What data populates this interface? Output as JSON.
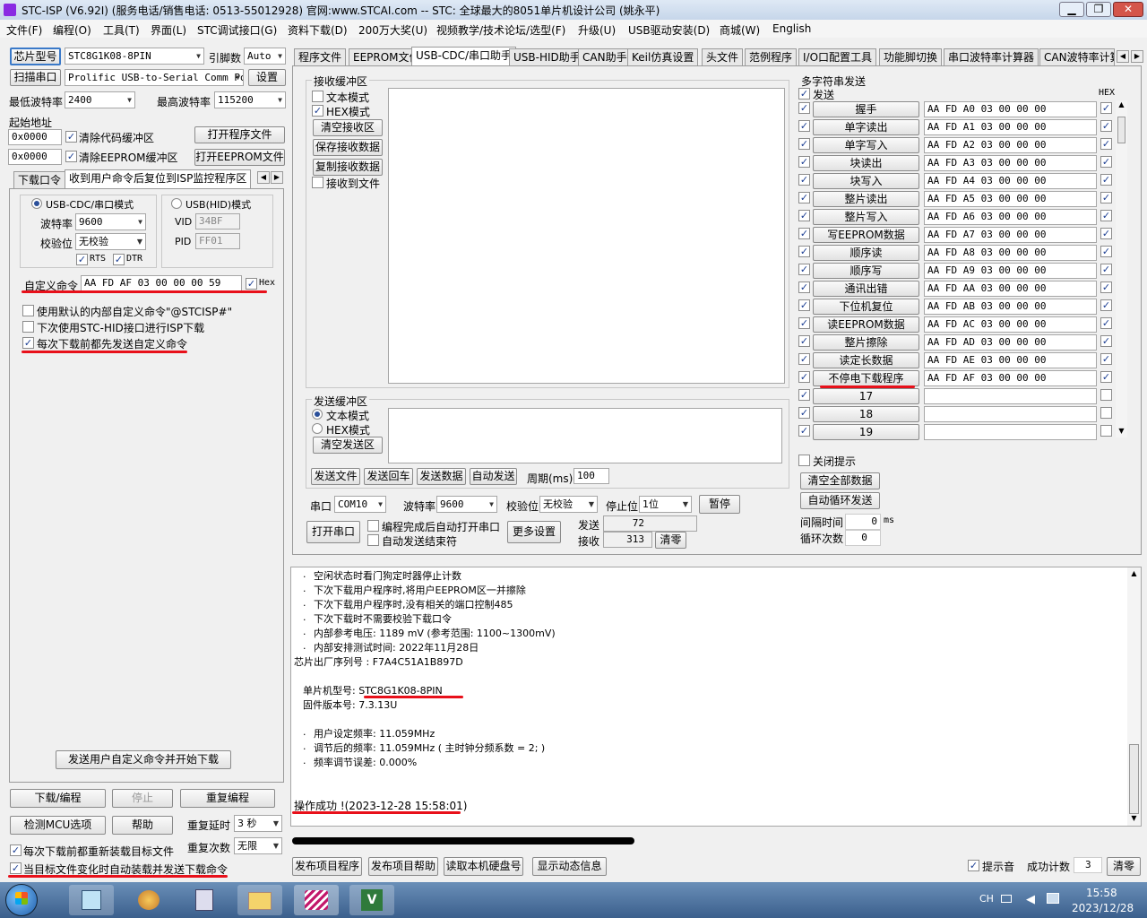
{
  "title": "STC-ISP (V6.92I) (服务电话/销售电话: 0513-55012928) 官网:www.STCAI.com  -- STC: 全球最大的8051单片机设计公司 (姚永平)",
  "menu": [
    "文件(F)",
    "编程(O)",
    "工具(T)",
    "界面(L)",
    "STC调试接口(G)",
    "资料下载(D)",
    "200万大奖(U)",
    "视频教学/技术论坛/选型(F)",
    "升级(U)",
    "USB驱动安装(D)",
    "商城(W)",
    "English"
  ],
  "left": {
    "chip_btn": "芯片型号",
    "chip_value": "STC8G1K08-8PIN",
    "pin_label": "引脚数",
    "pin_value": "Auto",
    "scan_btn": "扫描串口",
    "port_value": "Prolific USB-to-Serial Comm Po",
    "settings_btn": "设置",
    "min_baud_label": "最低波特率",
    "min_baud": "2400",
    "max_baud_label": "最高波特率",
    "max_baud": "115200",
    "start_addr_label": "起始地址",
    "addr1": "0x0000",
    "clr_code": "清除代码缓冲区",
    "open_prog": "打开程序文件",
    "addr2": "0x0000",
    "clr_eeprom": "清除EEPROM缓冲区",
    "open_eeprom": "打开EEPROM文件",
    "tab1": "下载口令",
    "tab2": "收到用户命令后复位到ISP监控程序区",
    "usb_cdc": "USB-CDC/串口模式",
    "usb_hid": "USB(HID)模式",
    "baud_label": "波特率",
    "baud": "9600",
    "parity_label": "校验位",
    "parity": "无校验",
    "vid_label": "VID",
    "vid": "34BF",
    "pid_label": "PID",
    "pid": "FF01",
    "rts": "RTS",
    "dtr": "DTR",
    "custom_label": "自定义命令",
    "custom_value": "AA FD AF 03 00 00 00 59",
    "hex": "Hex",
    "opt1": "使用默认的内部自定义命令\"@STCISP#\"",
    "opt2": "下次使用STC-HID接口进行ISP下载",
    "opt3": "每次下载前都先发送自定义命令",
    "send_dl": "发送用户自定义命令并开始下载",
    "download": "下载/编程",
    "stop": "停止",
    "reprogram": "重复编程",
    "check_mcu": "检测MCU选项",
    "help": "帮助",
    "delay_label": "重复延时",
    "delay": "3 秒",
    "count_label": "重复次数",
    "count": "无限",
    "reload": "每次下载前都重新装载目标文件",
    "autoload": "当目标文件变化时自动装载并发送下载命令"
  },
  "tabs": [
    "程序文件",
    "EEPROM文件",
    "USB-CDC/串口助手",
    "USB-HID助手",
    "CAN助手",
    "Keil仿真设置",
    "头文件",
    "范例程序",
    "I/O口配置工具",
    "功能脚切换",
    "串口波特率计算器",
    "CAN波特率计算"
  ],
  "recv": {
    "title": "接收缓冲区",
    "text_mode": "文本模式",
    "hex_mode": "HEX模式",
    "clear": "清空接收区",
    "save": "保存接收数据",
    "copy": "复制接收数据",
    "to_file": "接收到文件"
  },
  "send": {
    "title": "发送缓冲区",
    "text_mode": "文本模式",
    "hex_mode": "HEX模式",
    "clear": "清空发送区",
    "send_file": "发送文件",
    "send_cr": "发送回车",
    "send_data": "发送数据",
    "auto_send": "自动发送",
    "period_label": "周期(ms)",
    "period": "100"
  },
  "serial": {
    "port_label": "串口",
    "port": "COM10",
    "baud_label": "波特率",
    "baud": "9600",
    "parity_label": "校验位",
    "parity": "无校验",
    "stop_label": "停止位",
    "stop": "1位",
    "pause": "暂停",
    "open": "打开串口",
    "auto_open": "编程完成后自动打开串口",
    "auto_end": "自动发送结束符",
    "more": "更多设置",
    "tx_label": "发送",
    "tx": "72",
    "rx_label": "接收",
    "rx": "313",
    "clear": "清零"
  },
  "multi": {
    "title": "多字符串发送",
    "send": "发送",
    "hex": "HEX",
    "rows": [
      {
        "label": "握手",
        "data": "AA FD A0 03 00 00 00"
      },
      {
        "label": "单字读出",
        "data": "AA FD A1 03 00 00 00"
      },
      {
        "label": "单字写入",
        "data": "AA FD A2 03 00 00 00"
      },
      {
        "label": "块读出",
        "data": "AA FD A3 03 00 00 00"
      },
      {
        "label": "块写入",
        "data": "AA FD A4 03 00 00 00"
      },
      {
        "label": "整片读出",
        "data": "AA FD A5 03 00 00 00"
      },
      {
        "label": "整片写入",
        "data": "AA FD A6 03 00 00 00"
      },
      {
        "label": "写EEPROM数据",
        "data": "AA FD A7 03 00 00 00"
      },
      {
        "label": "顺序读",
        "data": "AA FD A8 03 00 00 00"
      },
      {
        "label": "顺序写",
        "data": "AA FD A9 03 00 00 00"
      },
      {
        "label": "通讯出错",
        "data": "AA FD AA 03 00 00 00"
      },
      {
        "label": "下位机复位",
        "data": "AA FD AB 03 00 00 00"
      },
      {
        "label": "读EEPROM数据",
        "data": "AA FD AC 03 00 00 00"
      },
      {
        "label": "整片擦除",
        "data": "AA FD AD 03 00 00 00"
      },
      {
        "label": "读定长数据",
        "data": "AA FD AE 03 00 00 00"
      },
      {
        "label": "不停电下载程序",
        "data": "AA FD AF 03 00 00 00"
      },
      {
        "label": "17",
        "data": ""
      },
      {
        "label": "18",
        "data": ""
      },
      {
        "label": "19",
        "data": ""
      }
    ],
    "close_hint": "关闭提示",
    "clear_all": "清空全部数据",
    "auto_loop": "自动循环发送",
    "interval_label": "间隔时间",
    "interval": "0",
    "interval_unit": "ms",
    "loop_label": "循环次数",
    "loop": "0"
  },
  "log": [
    "空闲状态时看门狗定时器停止计数",
    "下次下载用户程序时,将用户EEPROM区一并擦除",
    "下次下载用户程序时,没有相关的端口控制485",
    "下次下载时不需要校验下载口令",
    "内部参考电压: 1189 mV (参考范围: 1100~1300mV)",
    "内部安排测试时间: 2022年11月28日",
    "芯片出厂序列号 : F7A4C51A1B897D",
    "单片机型号: STC8G1K08-8PIN",
    "固件版本号: 7.3.13U",
    "用户设定频率: 11.059MHz",
    "调节后的频率: 11.059MHz ( 主时钟分频系数 = 2; )",
    "频率调节误差: 0.000%",
    "操作成功 !(2023-12-28 15:58:01)"
  ],
  "bottom": {
    "publish": "发布项目程序",
    "publish_help": "发布项目帮助",
    "read_disk": "读取本机硬盘号",
    "show_dyn": "显示动态信息",
    "beep": "提示音",
    "success_label": "成功计数",
    "success": "3",
    "clear": "清零"
  },
  "taskbar": {
    "lang": "CH",
    "time": "15:58",
    "date": "2023/12/28"
  }
}
